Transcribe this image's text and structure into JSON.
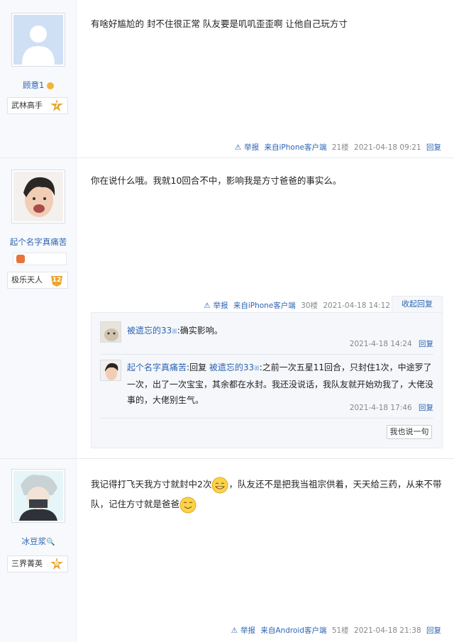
{
  "posts": [
    {
      "username": "顾意1",
      "level_title": "武林高手",
      "level": "7",
      "content": "有啥好尴尬的 封不住很正常 队友要是叽叽歪歪啊 让他自己玩方寸",
      "meta": {
        "report": "举报",
        "client": "来自iPhone客户端",
        "floor": "21楼",
        "time": "2021-04-18 09:21",
        "reply": "回复"
      }
    },
    {
      "username": "起个名字真痛苦",
      "level_title": "极乐天人",
      "level": "12",
      "content": "你在说什么哦。我就10回合不中，影响我是方寸爸爸的事实么。",
      "meta": {
        "report": "举报",
        "client": "来自iPhone客户端",
        "floor": "30楼",
        "time": "2021-04-18 14:12",
        "collapse": "收起回复"
      },
      "replies": [
        {
          "user": "被遗忘的33",
          "text": "确实影响。",
          "time": "2021-4-18 14:24",
          "reply": "回复"
        },
        {
          "user": "起个名字真痛苦",
          "prefix": "回复",
          "target": "被遗忘的33",
          "text": "之前一次五星11回合，只封住1次，中途罗了一次，出了一次宝宝，其余都在水封。我还没说话，我队友就开始劝我了，大佬没事的，大佬别生气。",
          "time": "2021-4-18 17:46",
          "reply": "回复"
        }
      ],
      "say_button": "我也说一句"
    },
    {
      "username": "冰豆浆",
      "level_title": "三界菁英",
      "level": "6",
      "content_part1": "我记得打飞天我方寸就封中2次",
      "content_part2": "，队友还不是把我当祖宗供着，天天给三药，从来不带",
      "content_part3": "队，记住方寸就是爸爸",
      "meta": {
        "report": "举报",
        "client": "来自Android客户端",
        "floor": "51楼",
        "time": "2021-04-18 21:38",
        "reply": "回复"
      }
    }
  ],
  "colors": {
    "link": "#2d64b3",
    "badge": "#e9a630"
  },
  "icons": [
    "warning-icon",
    "vip-icon",
    "emoji-smile-icon",
    "emoji-grin-icon"
  ]
}
